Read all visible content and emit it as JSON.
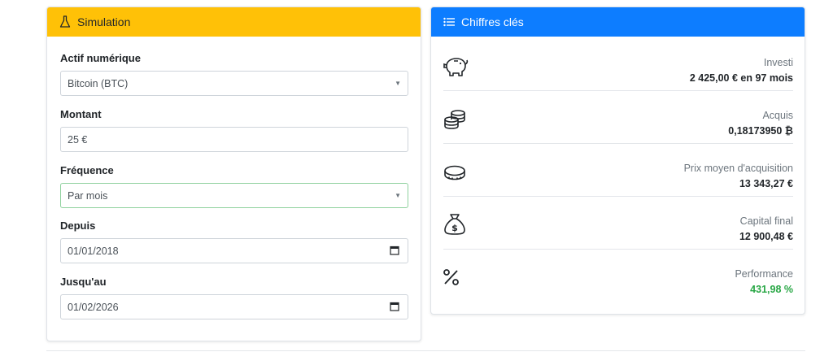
{
  "simulation": {
    "title": "Simulation",
    "asset": {
      "label": "Actif numérique",
      "value": "Bitcoin (BTC)"
    },
    "amount": {
      "label": "Montant",
      "value": "25 €"
    },
    "frequency": {
      "label": "Fréquence",
      "value": "Par mois"
    },
    "from": {
      "label": "Depuis",
      "value": "01/01/2018"
    },
    "to": {
      "label": "Jusqu'au",
      "value": "01/02/2026"
    }
  },
  "kpis": {
    "title": "Chiffres clés",
    "items": [
      {
        "icon": "piggy-bank-icon",
        "label": "Investi",
        "value": "2 425,00 € en 97 mois"
      },
      {
        "icon": "coins-icon",
        "label": "Acquis",
        "value": "0,18173950 ₿"
      },
      {
        "icon": "coin-icon",
        "label": "Prix moyen d'acquisition",
        "value": "13 343,27 €"
      },
      {
        "icon": "money-bag-icon",
        "label": "Capital final",
        "value": "12 900,48 €"
      },
      {
        "icon": "percent-icon",
        "label": "Performance",
        "value": "431,98 %"
      }
    ],
    "positive_color": "#28a745"
  },
  "colors": {
    "simulation_header": "#ffc107",
    "kpi_header": "#0d7dff"
  }
}
